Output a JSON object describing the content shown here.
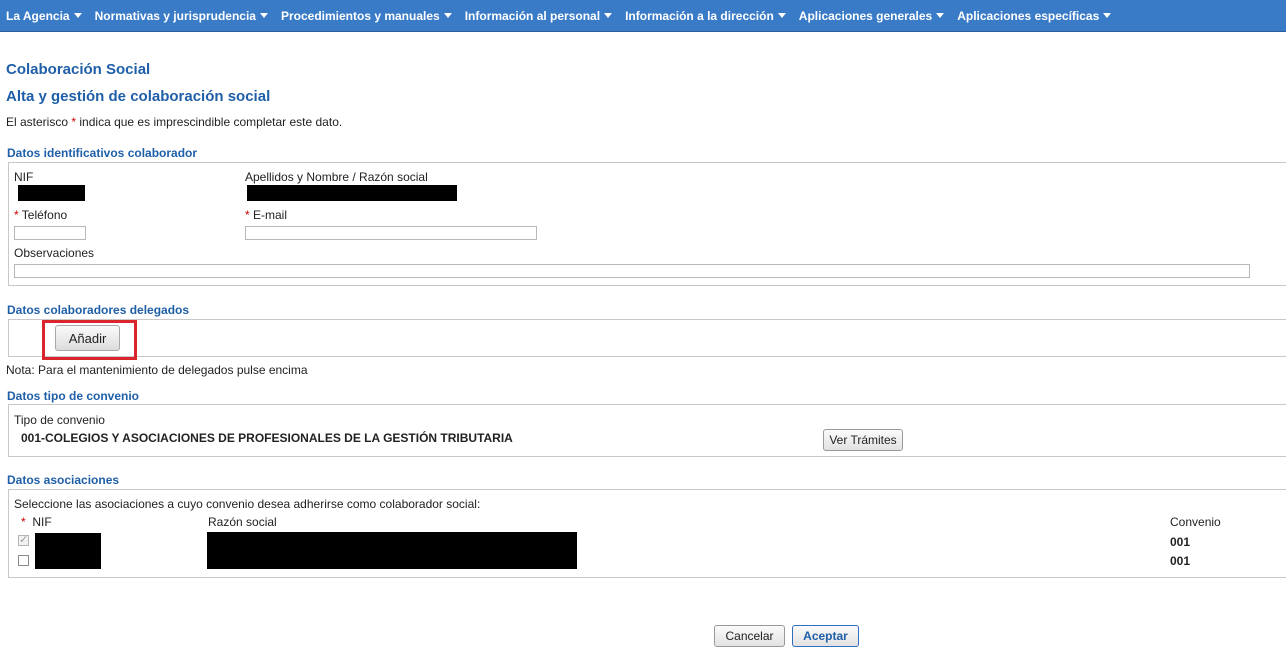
{
  "nav": [
    "La Agencia",
    "Normativas y jurisprudencia",
    "Procedimientos y manuales",
    "Información al personal",
    "Información a la dirección",
    "Aplicaciones generales",
    "Aplicaciones específicas"
  ],
  "page": {
    "title": "Colaboración Social",
    "subtitle": "Alta y gestión de colaboración social",
    "note_prefix": "El asterisco",
    "asterisk": "*",
    "note_suffix": "indica que es imprescindible completar este dato."
  },
  "identificativos": {
    "heading": "Datos identificativos colaborador",
    "nif_label": "NIF",
    "name_label": "Apellidos y Nombre / Razón social",
    "phone_label": "Teléfono",
    "email_label": "E-mail",
    "obs_label": "Observaciones",
    "phone_value": "",
    "email_value": "",
    "obs_value": ""
  },
  "delegados": {
    "heading": "Datos colaboradores delegados",
    "add_label": "Añadir",
    "note": "Nota: Para el mantenimiento de delegados pulse encima"
  },
  "convenio": {
    "heading": "Datos tipo de convenio",
    "type_label": "Tipo de convenio",
    "type_value": "001-COLEGIOS Y ASOCIACIONES DE PROFESIONALES DE LA GESTIÓN TRIBUTARIA",
    "ver_label": "Ver Trámites"
  },
  "asociaciones": {
    "heading": "Datos asociaciones",
    "instructions": "Seleccione las asociaciones a cuyo convenio desea adherirse como colaborador social:",
    "col_nif": "NIF",
    "col_razon": "Razón social",
    "col_convenio": "Convenio",
    "rows": [
      {
        "checked": true,
        "convenio": "001"
      },
      {
        "checked": false,
        "convenio": "001"
      }
    ]
  },
  "actions": {
    "cancel": "Cancelar",
    "accept": "Aceptar"
  }
}
